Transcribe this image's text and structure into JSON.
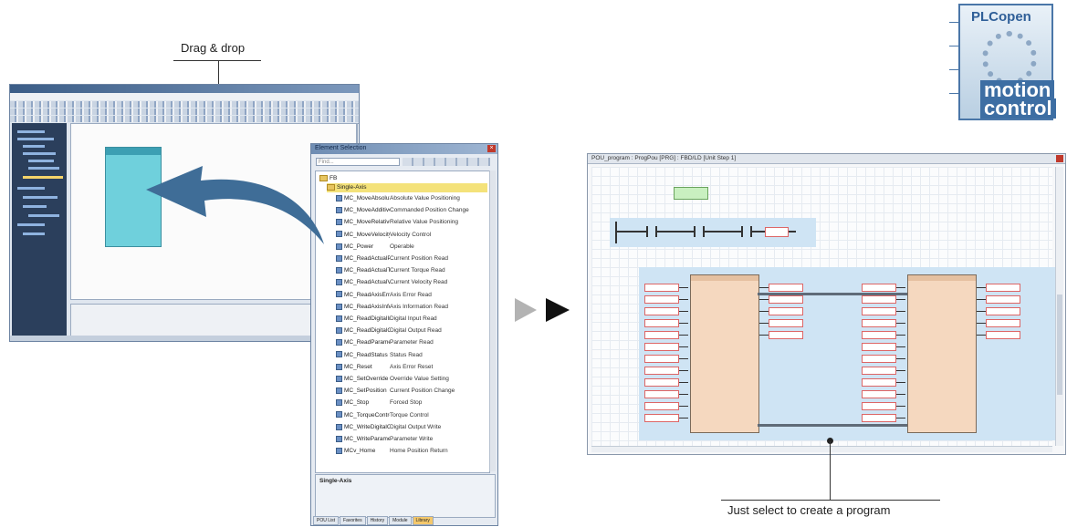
{
  "callouts": {
    "drag_drop": "Drag & drop",
    "just_select": "Just select to create a program"
  },
  "logo": {
    "top_text": "PLCopen",
    "line1": "motion",
    "line2": "control"
  },
  "element_selection": {
    "title": "Element Selection",
    "search_placeholder": "Find...",
    "tree_root": "FB",
    "tree_group": "Single-Axis",
    "items": [
      {
        "name": "MC_MoveAbsolute",
        "desc": "Absolute Value Positioning"
      },
      {
        "name": "MC_MoveAdditive",
        "desc": "Commanded Position Change"
      },
      {
        "name": "MC_MoveRelative",
        "desc": "Relative Value Positioning"
      },
      {
        "name": "MC_MoveVelocity",
        "desc": "Velocity Control"
      },
      {
        "name": "MC_Power",
        "desc": "Operable"
      },
      {
        "name": "MC_ReadActualPo",
        "desc": "Current Position Read"
      },
      {
        "name": "MC_ReadActualTo",
        "desc": "Current Torque Read"
      },
      {
        "name": "MC_ReadActualVe",
        "desc": "Current Velocity Read"
      },
      {
        "name": "MC_ReadAxisErro",
        "desc": "Axis Error Read"
      },
      {
        "name": "MC_ReadAxisInfo",
        "desc": "Axis Information Read"
      },
      {
        "name": "MC_ReadDigitalIn",
        "desc": "Digital Input Read"
      },
      {
        "name": "MC_ReadDigitalOu",
        "desc": "Digital Output Read"
      },
      {
        "name": "MC_ReadParamet",
        "desc": "Parameter Read"
      },
      {
        "name": "MC_ReadStatus",
        "desc": "Status Read"
      },
      {
        "name": "MC_Reset",
        "desc": "Axis Error Reset"
      },
      {
        "name": "MC_SetOverride",
        "desc": "Override Value Setting"
      },
      {
        "name": "MC_SetPosition",
        "desc": "Current Position Change"
      },
      {
        "name": "MC_Stop",
        "desc": "Forced Stop"
      },
      {
        "name": "MC_TorqueContro",
        "desc": "Torque Control"
      },
      {
        "name": "MC_WriteDigitalO",
        "desc": "Digital Output Write"
      },
      {
        "name": "MC_WriteParamet",
        "desc": "Parameter Write"
      },
      {
        "name": "MCv_Home",
        "desc": "Home Position Return"
      }
    ],
    "description_label": "Single-Axis",
    "tabs": [
      "POU List",
      "Favorites",
      "History",
      "Module",
      "Library"
    ],
    "active_tab": "Library"
  },
  "program_window": {
    "title": "POU_program : ProgPou [PRG] : FBD/LD [Unit Step 1]"
  },
  "colors": {
    "accent_arrow": "#3f6d97",
    "play_light": "#b3b3b3",
    "play_dark": "#111111",
    "fb_block": "#f5d8bf",
    "fbd_zone": "#cfe4f4",
    "selected_row": "#f4e27a"
  }
}
